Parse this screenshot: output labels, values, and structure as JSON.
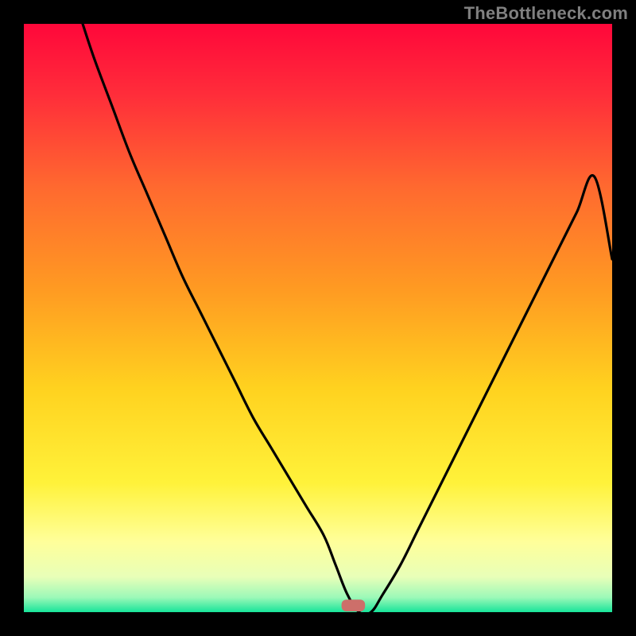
{
  "attribution": "TheBottleneck.com",
  "chart_data": {
    "type": "line",
    "title": "",
    "xlabel": "",
    "ylabel": "",
    "xlim": [
      0,
      100
    ],
    "ylim": [
      0,
      100
    ],
    "grid": false,
    "legend": false,
    "annotations": [],
    "marker": {
      "x": 56,
      "y": 0,
      "width": 4,
      "height": 2,
      "color": "#cd6f6a"
    },
    "series": [
      {
        "name": "curve",
        "color": "#000000",
        "x": [
          10,
          12,
          15,
          18,
          21,
          24,
          27,
          30,
          33,
          36,
          39,
          42,
          45,
          48,
          51,
          53,
          55,
          57,
          59,
          61,
          64,
          67,
          70,
          73,
          76,
          79,
          82,
          85,
          88,
          91,
          94,
          97,
          100
        ],
        "y": [
          100,
          94,
          86,
          78,
          71,
          64,
          57,
          51,
          45,
          39,
          33,
          28,
          23,
          18,
          13,
          8,
          3,
          0,
          0,
          3,
          8,
          14,
          20,
          26,
          32,
          38,
          44,
          50,
          56,
          62,
          68,
          74,
          60
        ]
      }
    ],
    "background_gradient": {
      "stops": [
        {
          "pos": 0.0,
          "color": "#ff073a"
        },
        {
          "pos": 0.12,
          "color": "#ff2d3a"
        },
        {
          "pos": 0.28,
          "color": "#ff6a2f"
        },
        {
          "pos": 0.45,
          "color": "#ff9a22"
        },
        {
          "pos": 0.62,
          "color": "#ffd21f"
        },
        {
          "pos": 0.78,
          "color": "#fff23a"
        },
        {
          "pos": 0.88,
          "color": "#ffff9a"
        },
        {
          "pos": 0.94,
          "color": "#e8ffb8"
        },
        {
          "pos": 0.975,
          "color": "#9cf9b8"
        },
        {
          "pos": 1.0,
          "color": "#17e49a"
        }
      ]
    }
  }
}
